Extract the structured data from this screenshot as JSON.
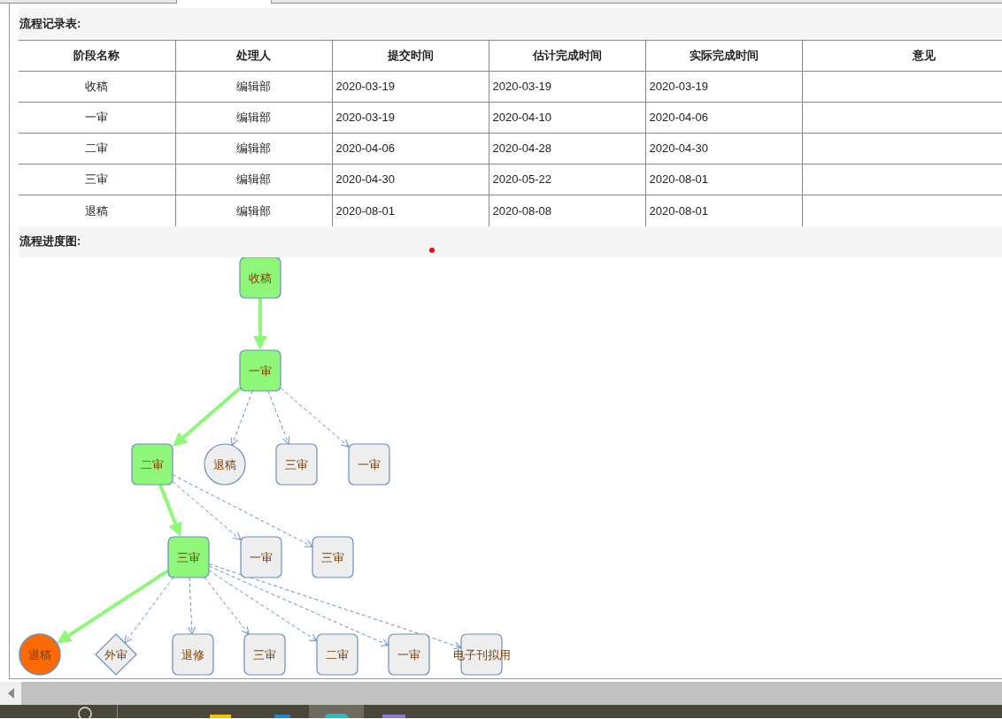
{
  "record_table": {
    "title": "流程记录表:",
    "columns": [
      "阶段名称",
      "处理人",
      "提交时间",
      "估计完成时间",
      "实际完成时间",
      "意见"
    ],
    "rows": [
      {
        "stage": "收稿",
        "handler": "编辑部",
        "submitted": "2020-03-19",
        "estimated": "2020-03-19",
        "actual": "2020-03-19"
      },
      {
        "stage": "一审",
        "handler": "编辑部",
        "submitted": "2020-03-19",
        "estimated": "2020-04-10",
        "actual": "2020-04-06"
      },
      {
        "stage": "二审",
        "handler": "编辑部",
        "submitted": "2020-04-06",
        "estimated": "2020-04-28",
        "actual": "2020-04-30"
      },
      {
        "stage": "三审",
        "handler": "编辑部",
        "submitted": "2020-04-30",
        "estimated": "2020-05-22",
        "actual": "2020-08-01"
      },
      {
        "stage": "退稿",
        "handler": "编辑部",
        "submitted": "2020-08-01",
        "estimated": "2020-08-08",
        "actual": "2020-08-01"
      }
    ]
  },
  "flow_chart": {
    "title": "流程进度图:",
    "root": {
      "label": "收稿",
      "kind": "rect",
      "color": "#8ef77a",
      "visited": true,
      "children": [
        {
          "label": "一审",
          "kind": "rect",
          "color": "#8ef77a",
          "visited": true,
          "children": [
            {
              "label": "二审",
              "kind": "rect",
              "color": "#8ef77a",
              "visited": true,
              "children": [
                {
                  "label": "三审",
                  "kind": "rect",
                  "color": "#8ef77a",
                  "visited": true,
                  "children": [
                    {
                      "label": "退稿",
                      "kind": "circle",
                      "color": "#ff6a00",
                      "visited": true
                    },
                    {
                      "label": "外审",
                      "kind": "diamond",
                      "color": "#eeeeee",
                      "visited": false
                    },
                    {
                      "label": "退修",
                      "kind": "rect",
                      "color": "#eeeeee",
                      "visited": false
                    },
                    {
                      "label": "三审",
                      "kind": "rect",
                      "color": "#eeeeee",
                      "visited": false
                    },
                    {
                      "label": "二审",
                      "kind": "rect",
                      "color": "#eeeeee",
                      "visited": false
                    },
                    {
                      "label": "一审",
                      "kind": "rect",
                      "color": "#eeeeee",
                      "visited": false
                    },
                    {
                      "label": "电子刊拟用",
                      "kind": "rect",
                      "color": "#eeeeee",
                      "visited": false
                    }
                  ]
                },
                {
                  "label": "一审",
                  "kind": "rect",
                  "color": "#eeeeee",
                  "visited": false
                },
                {
                  "label": "三审",
                  "kind": "rect",
                  "color": "#eeeeee",
                  "visited": false
                }
              ]
            },
            {
              "label": "退稿",
              "kind": "circle",
              "color": "#eeeeee",
              "visited": false
            },
            {
              "label": "三审",
              "kind": "rect",
              "color": "#eeeeee",
              "visited": false
            },
            {
              "label": "一审",
              "kind": "rect",
              "color": "#eeeeee",
              "visited": false
            }
          ]
        }
      ]
    }
  }
}
